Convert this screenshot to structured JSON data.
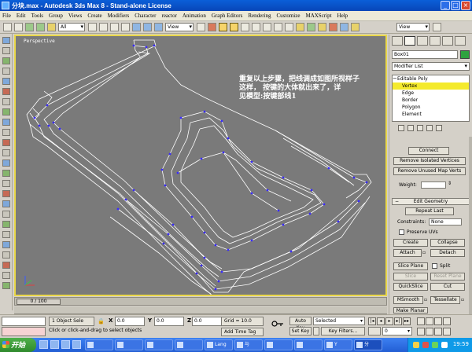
{
  "window": {
    "title": "分块.max - Autodesk 3ds Max 8 - Stand-alone License"
  },
  "menu": [
    "File",
    "Edit",
    "Tools",
    "Group",
    "Views",
    "Create",
    "Modifiers",
    "Character",
    "reactor",
    "Animation",
    "Graph Editors",
    "Rendering",
    "Customize",
    "MAXScript",
    "Help"
  ],
  "toolbar": {
    "selection_filter": "All",
    "coordinate_system": "View",
    "render_type": "View"
  },
  "viewport": {
    "label": "Perspective",
    "caption_lines": [
      "重复以上步骤，把线调成如图所视样子",
      "这样，  按键的大体就出来了，详",
      "见模型:按键部线1"
    ]
  },
  "timeline": {
    "frame_readout": "0 / 100"
  },
  "panel": {
    "object_name": "Box01",
    "modifier_list": "Modifier List",
    "stack": [
      "Editable Poly",
      "Vertex",
      "Edge",
      "Border",
      "Polygon",
      "Element"
    ],
    "weight_label": "Weight:",
    "rollouts": {
      "edit_geometry": "Edit Geometry"
    },
    "constraints_label": "Constraints:",
    "constraints_value": "None",
    "preserve_uvs": "Preserve UVs",
    "split": "Split",
    "buttons": {
      "connect": "Connect",
      "remove_isolated": "Remove Isolated Vertices",
      "remove_unused": "Remove Unused Map Verts",
      "repeat_last": "Repeat Last",
      "create": "Create",
      "collapse": "Collapse",
      "attach": "Attach",
      "detach": "Detach",
      "slice_plane": "Slice Plane",
      "slice": "Slice",
      "reset_plane": "Reset Plane",
      "quickslice": "QuickSlice",
      "cut": "Cut",
      "msmooth": "MSmooth",
      "tessellate": "Tessellate",
      "make_planar": "Make Planar"
    }
  },
  "status": {
    "selection": "1 Object Sele",
    "x_label": "X",
    "x_value": "0.0",
    "y_label": "Y",
    "y_value": "0.0",
    "z_label": "Z",
    "z_value": "0.0",
    "grid": "Grid = 10.0",
    "prompt": "Click or click-and-drag to select objects",
    "add_time_tag": "Add Time Tag",
    "auto_key": "Auto Key",
    "selected_set": "Selected",
    "set_key": "Set Key",
    "key_filters": "Key Filters...",
    "current_frame": "0"
  },
  "taskbar": {
    "start": "开始",
    "tasks": [
      "",
      "",
      "",
      "",
      "Lang",
      "与",
      "",
      "",
      "Y",
      "分"
    ],
    "clock": "19:59"
  }
}
